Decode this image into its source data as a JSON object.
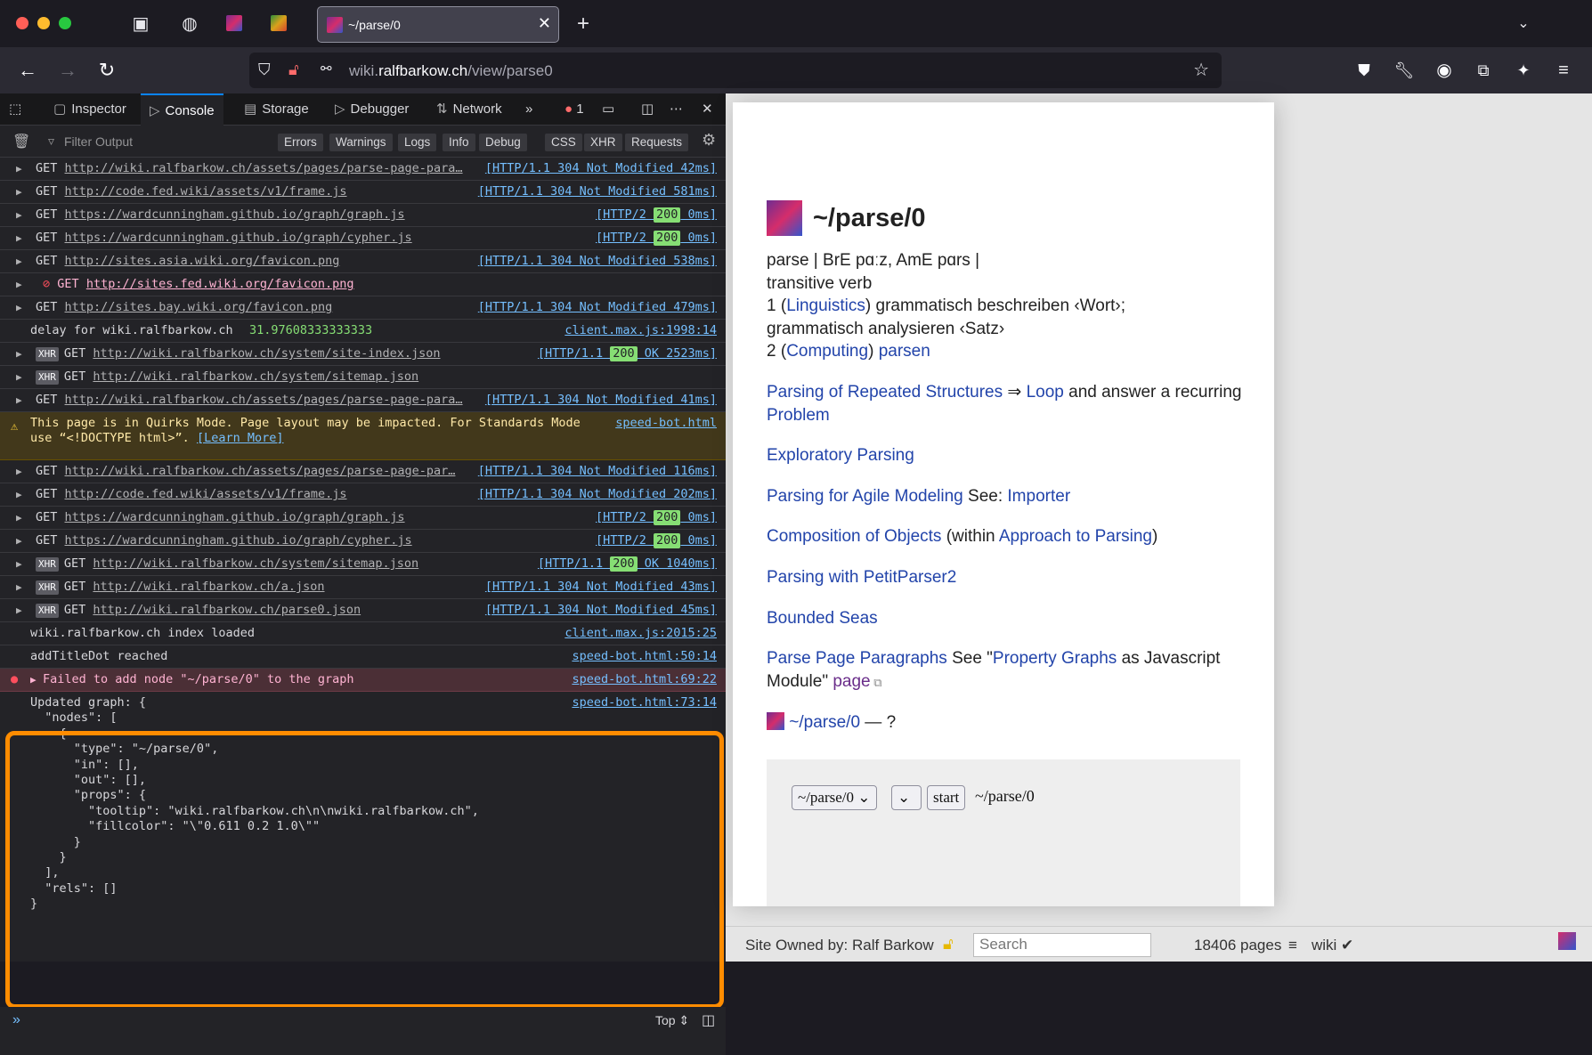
{
  "browser": {
    "tab_title": "~/parse/0",
    "url_domain": "wiki.",
    "url_host": "ralfbarkow.ch",
    "url_path": "/view/parse0"
  },
  "devtools": {
    "tabs": [
      "Inspector",
      "Console",
      "Storage",
      "Debugger",
      "Network"
    ],
    "error_count": "1",
    "filter_placeholder": "Filter Output",
    "filters": [
      "Errors",
      "Warnings",
      "Logs",
      "Info",
      "Debug",
      "CSS",
      "XHR",
      "Requests"
    ],
    "context": "Top",
    "log_rows": [
      {
        "method": "GET",
        "url": "http://wiki.ralfbarkow.ch/assets/pages/parse-page-para…",
        "status_pre": "[HTTP/1.1 304 Not Modified 42ms]",
        "xhr": false
      },
      {
        "method": "GET",
        "url": "http://code.fed.wiki/assets/v1/frame.js",
        "status_pre": "[HTTP/1.1 304 Not Modified 581ms]",
        "xhr": false
      },
      {
        "method": "GET",
        "url": "https://wardcunningham.github.io/graph/graph.js",
        "status_pre": "[HTTP/2 ",
        "code": "200",
        "status_post": " 0ms]",
        "xhr": false
      },
      {
        "method": "GET",
        "url": "https://wardcunningham.github.io/graph/cypher.js",
        "status_pre": "[HTTP/2 ",
        "code": "200",
        "status_post": " 0ms]",
        "xhr": false
      },
      {
        "method": "GET",
        "url": "http://sites.asia.wiki.org/favicon.png",
        "status_pre": "[HTTP/1.1 304 Not Modified 538ms]",
        "xhr": false
      },
      {
        "method": "GET",
        "url": "http://sites.fed.wiki.org/favicon.png",
        "blocked": true
      },
      {
        "method": "GET",
        "url": "http://sites.bay.wiki.org/favicon.png",
        "status_pre": "[HTTP/1.1 304 Not Modified 479ms]",
        "xhr": false
      }
    ],
    "delay_text": "delay for  wiki.ralfbarkow.ch ",
    "delay_value": "31.97608333333333",
    "delay_source": "client.max.js:1998:14",
    "log_rows2": [
      {
        "method": "GET",
        "url": "http://wiki.ralfbarkow.ch/system/site-index.json",
        "status_pre": "[HTTP/1.1 ",
        "code": "200",
        "status_post": " OK 2523ms]",
        "xhr": true
      },
      {
        "method": "GET",
        "url": "http://wiki.ralfbarkow.ch/system/sitemap.json",
        "status_pre": "",
        "xhr": true
      },
      {
        "method": "GET",
        "url": "http://wiki.ralfbarkow.ch/assets/pages/parse-page-para…",
        "status_pre": "[HTTP/1.1 304 Not Modified 41ms]",
        "xhr": false
      }
    ],
    "warning_line1": "This page is in Quirks Mode. Page layout may be impacted. For Standards Mode",
    "warning_line2": "use “<!DOCTYPE html>”. ",
    "warning_learn": "[Learn More]",
    "warning_source": "speed-bot.html",
    "log_rows3": [
      {
        "method": "GET",
        "url": "http://wiki.ralfbarkow.ch/assets/pages/parse-page-par…",
        "status_pre": "[HTTP/1.1 304 Not Modified 116ms]",
        "xhr": false
      },
      {
        "method": "GET",
        "url": "http://code.fed.wiki/assets/v1/frame.js",
        "status_pre": "[HTTP/1.1 304 Not Modified 202ms]",
        "xhr": false
      },
      {
        "method": "GET",
        "url": "https://wardcunningham.github.io/graph/graph.js",
        "status_pre": "[HTTP/2 ",
        "code": "200",
        "status_post": " 0ms]",
        "xhr": false
      },
      {
        "method": "GET",
        "url": "https://wardcunningham.github.io/graph/cypher.js",
        "status_pre": "[HTTP/2 ",
        "code": "200",
        "status_post": " 0ms]",
        "xhr": false
      },
      {
        "method": "GET",
        "url": "http://wiki.ralfbarkow.ch/system/sitemap.json",
        "status_pre": "[HTTP/1.1 ",
        "code": "200",
        "status_post": " OK 1040ms]",
        "xhr": true
      },
      {
        "method": "GET",
        "url": "http://wiki.ralfbarkow.ch/a.json",
        "status_pre": "[HTTP/1.1 304 Not Modified 43ms]",
        "xhr": true
      },
      {
        "method": "GET",
        "url": "http://wiki.ralfbarkow.ch/parse0.json",
        "status_pre": "[HTTP/1.1 304 Not Modified 45ms]",
        "xhr": true
      }
    ],
    "index_loaded": "wiki.ralfbarkow.ch index loaded",
    "index_source": "client.max.js:2015:25",
    "title_dot": "addTitleDot reached",
    "title_dot_source": "speed-bot.html:50:14",
    "error_msg": "Failed to add node \"~/parse/0\" to the graph",
    "error_source": "speed-bot.html:69:22",
    "graph_source": "speed-bot.html:73:14",
    "graph_dump": "Updated graph: {\n  \"nodes\": [\n    {\n      \"type\": \"~/parse/0\",\n      \"in\": [],\n      \"out\": [],\n      \"props\": {\n        \"tooltip\": \"wiki.ralfbarkow.ch\\n\\nwiki.ralfbarkow.ch\",\n        \"fillcolor\": \"\\\"0.611 0.2 1.0\\\"\"\n      }\n    }\n  ],\n  \"rels\": []\n}"
  },
  "wiki": {
    "title": "~/parse/0",
    "def_line1": "parse | BrE pɑːz, AmE pɑrs |",
    "def_line2": "transitive verb",
    "def_1_pre": "1 (",
    "def_1_link": "Linguistics",
    "def_1_post": ") grammatisch beschreiben ‹Wort›;",
    "def_1_cont": "grammatisch analysieren ‹Satz›",
    "def_2_pre": "2 (",
    "def_2_link": "Computing",
    "def_2_post": ") ",
    "def_2_link2": "parsen",
    "p_repeat_link": "Parsing of Repeated Structures",
    "p_repeat_mid": " ⇒ ",
    "p_repeat_link2": "Loop",
    "p_repeat_post": " and answer a recurring ",
    "p_repeat_link3": "Problem",
    "p_explor": "Exploratory Parsing",
    "p_agile_link": "Parsing for Agile Modeling",
    "p_agile_mid": " See: ",
    "p_agile_link2": "Importer",
    "p_comp_link": "Composition of Objects",
    "p_comp_mid": " (within ",
    "p_comp_link2": "Approach to Parsing",
    "p_comp_post": ")",
    "p_petit": "Parsing with PetitParser2",
    "p_bounded": "Bounded Seas",
    "p_ppp_link": "Parse Page Paragraphs",
    "p_ppp_mid": " See \"",
    "p_ppp_link2": "Property Graphs",
    "p_ppp_post": " as Javascript Module\" ",
    "p_ppp_link3": "page",
    "ref_link": "~/parse/0",
    "ref_post": " — ?",
    "form_select": "~/parse/0",
    "form_start": "start",
    "form_label": "~/parse/0",
    "footer_owner": "Site Owned by: Ralf Barkow",
    "footer_search": "Search",
    "footer_pages": "18406 pages",
    "footer_wiki": "wiki ✔"
  },
  "colors": {
    "accent": "#0a84ff",
    "highlight": "#ff8c00",
    "link": "#2244aa"
  }
}
